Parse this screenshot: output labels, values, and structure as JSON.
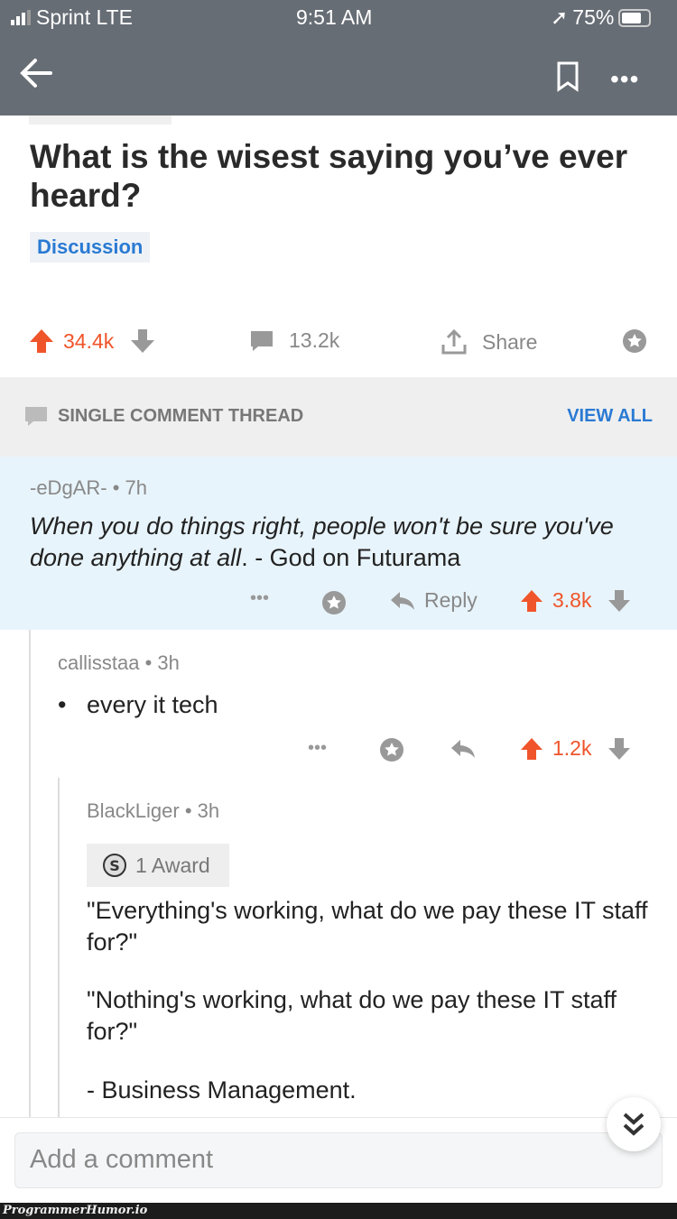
{
  "status_bar": {
    "carrier": "Sprint LTE",
    "time": "9:51 AM",
    "battery": "75%"
  },
  "post": {
    "title": "What is the wisest saying you’ve ever heard?",
    "flair": "Discussion",
    "upvotes": "34.4k",
    "comments": "13.2k",
    "share_label": "Share"
  },
  "thread_bar": {
    "label": "SINGLE COMMENT THREAD",
    "view_all": "VIEW ALL"
  },
  "comments": [
    {
      "author": "-eDgAR-",
      "age": "7h",
      "text_italic": "When you do things right, people won't be sure you've done anything at all",
      "text_rest": ". - God on Futurama",
      "reply_label": "Reply",
      "score": "3.8k"
    },
    {
      "author": "callisstaa",
      "age": "3h",
      "bullet": "every it tech",
      "score": "1.2k"
    },
    {
      "author": "BlackLiger",
      "age": "3h",
      "award": "1 Award",
      "paragraphs": [
        "\"Everything's working, what do we pay these IT staff for?\"",
        "\"Nothing's working, what do we pay these IT staff for?\"",
        "- Business Management."
      ]
    }
  ],
  "composer": {
    "placeholder": "Add a comment"
  },
  "watermark": "ProgrammerHumor.io",
  "colors": {
    "nav": "#676d75",
    "upvote": "#f0542a",
    "link": "#2a7ad3",
    "highlight": "#e8f4fb"
  }
}
